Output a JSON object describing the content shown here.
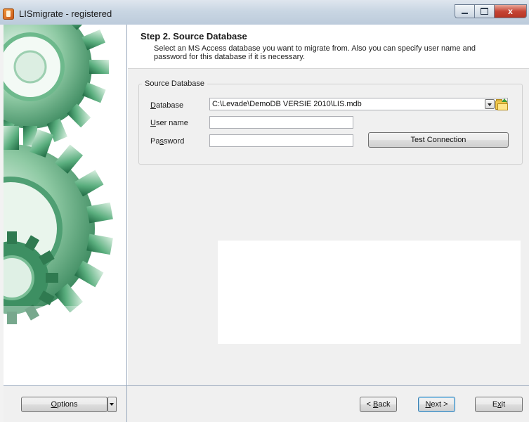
{
  "window": {
    "title": "LISmigrate - registered",
    "close_glyph": "x"
  },
  "header": {
    "step_title": "Step 2. Source Database",
    "description": "Select an MS Access database you want to migrate from. Also you can specify user name and password for this database if it is necessary."
  },
  "group": {
    "legend": "Source Database"
  },
  "fields": {
    "database": {
      "label_prefix": "D",
      "label_rest": "atabase",
      "value": "C:\\Levade\\DemoDB VERSIE 2010\\LIS.mdb"
    },
    "username": {
      "label_prefix": "U",
      "label_rest": "ser name",
      "value": ""
    },
    "password": {
      "label_pre": "Pa",
      "label_hot": "s",
      "label_post": "sword",
      "value": ""
    }
  },
  "buttons": {
    "test_connection": "Test Connection",
    "options_hot": "O",
    "options_rest": "ptions",
    "back_pre": "< ",
    "back_hot": "B",
    "back_rest": "ack",
    "next_hot": "N",
    "next_rest": "ext >",
    "exit_pre": "E",
    "exit_hot": "x",
    "exit_rest": "it"
  },
  "icons": {
    "app": "app-icon",
    "minimize": "minimize-icon",
    "maximize": "maximize-icon",
    "close": "close-icon",
    "dropdown": "chevron-down-icon",
    "browse": "open-folder-icon",
    "illustration": "gears-illustration"
  },
  "colors": {
    "gear_green": "#3f9a6a",
    "frame_border": "#9aa9bd",
    "close_red": "#c64535"
  }
}
